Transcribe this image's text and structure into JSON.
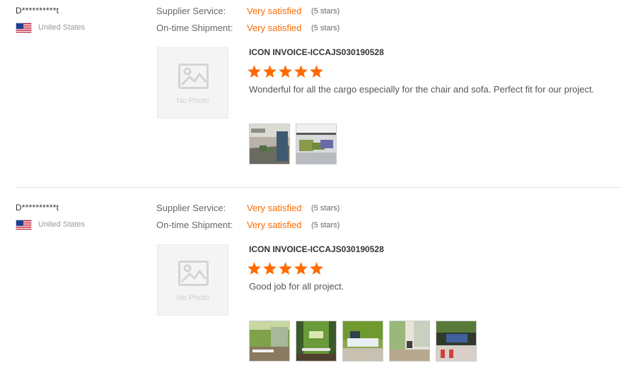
{
  "reviews": [
    {
      "buyer": "D**********t",
      "country": "United States",
      "flag_icon": "us-flag-icon",
      "metrics": [
        {
          "label": "Supplier Service:",
          "value": "Very satisfied",
          "stars_text": "(5 stars)"
        },
        {
          "label": "On-time Shipment:",
          "value": "Very satisfied",
          "stars_text": "(5 stars)"
        }
      ],
      "no_photo_label": "No Photo",
      "product": "ICON INVOICE-ICCAJS030190528",
      "rating": 5,
      "comment": "Wonderful for all the cargo especially for the chair and sofa. Perfect fit for our project.",
      "photo_count": 2
    },
    {
      "buyer": "D**********t",
      "country": "United States",
      "flag_icon": "us-flag-icon",
      "metrics": [
        {
          "label": "Supplier Service:",
          "value": "Very satisfied",
          "stars_text": "(5 stars)"
        },
        {
          "label": "On-time Shipment:",
          "value": "Very satisfied",
          "stars_text": "(5 stars)"
        }
      ],
      "no_photo_label": "No Photo",
      "product": "ICON INVOICE-ICCAJS030190528",
      "rating": 5,
      "comment": "Good job for all project.",
      "photo_count": 5
    }
  ],
  "colors": {
    "accent": "#ff6a00",
    "label": "#666666",
    "muted": "#999999",
    "divider": "#e0e0e0"
  }
}
